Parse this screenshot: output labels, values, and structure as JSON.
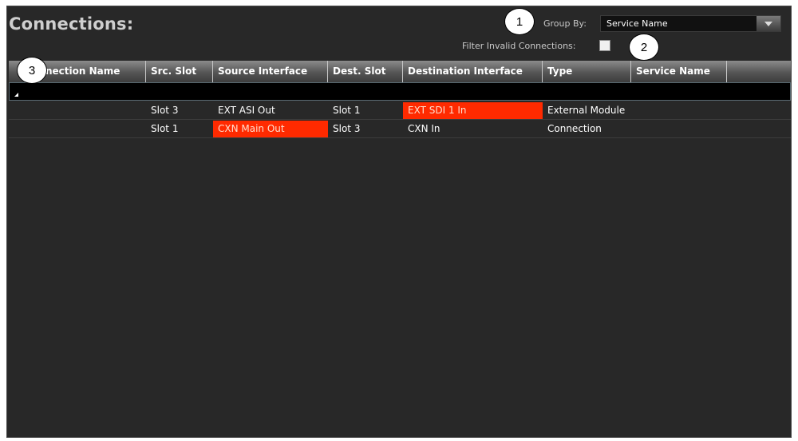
{
  "panel": {
    "title": "Connections:",
    "group_by": {
      "label": "Group By:",
      "value": "Service Name"
    },
    "filter_invalid": {
      "label": "Filter Invalid Connections:",
      "checked": false
    }
  },
  "table": {
    "columns": [
      "nection Name",
      "Src. Slot",
      "Source Interface",
      "Dest. Slot",
      "Destination Interface",
      "Type",
      "Service Name"
    ],
    "rows": [
      {
        "connection_name": "",
        "src_slot": "Slot 3",
        "source_interface": "EXT ASI Out",
        "dest_slot": "Slot 1",
        "destination_interface": "EXT SDI 1 In",
        "type": "External Module",
        "service_name": ""
      },
      {
        "connection_name": "",
        "src_slot": "Slot 1",
        "source_interface": "CXN Main Out",
        "dest_slot": "Slot 3",
        "destination_interface": "CXN In",
        "type": "Connection",
        "service_name": ""
      }
    ]
  },
  "callouts": [
    "1",
    "2",
    "3"
  ],
  "colors": {
    "panel_bg": "#282828",
    "invalid_highlight": "#ff2a00",
    "header_text": "#ffffff"
  },
  "icons": {
    "dropdown": "chevron-down-icon",
    "filter_row_marker": "triangle-icon"
  }
}
